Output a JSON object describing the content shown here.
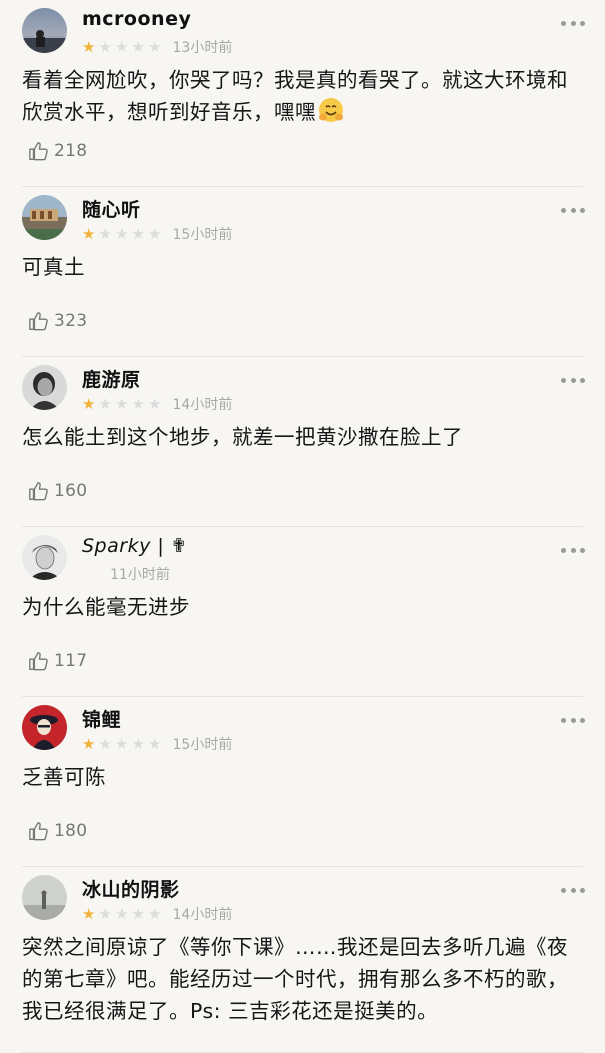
{
  "comments": [
    {
      "username": "mcrooney",
      "rating": 1,
      "max_rating": 5,
      "time": "13小时前",
      "text": "看着全网尬吹，你哭了吗？我是真的看哭了。就这大环境和欣赏水平，想听到好音乐，嘿嘿",
      "emoji": "hugging-face",
      "likes": "218",
      "avatar": "landscape-photo"
    },
    {
      "username": "随心听",
      "rating": 1,
      "max_rating": 5,
      "time": "15小时前",
      "text": "可真土",
      "likes": "323",
      "avatar": "building-photo"
    },
    {
      "username": "鹿游原",
      "rating": 1,
      "max_rating": 5,
      "time": "14小时前",
      "text": "怎么能土到这个地步，就差一把黄沙撒在脸上了",
      "likes": "160",
      "avatar": "portrait-bw"
    },
    {
      "username": "Sparky | ✟",
      "rating": null,
      "time": "11小时前",
      "text": "为什么能毫无进步",
      "likes": "117",
      "avatar": "portrait-sketch"
    },
    {
      "username": "锦鲤",
      "rating": 1,
      "max_rating": 5,
      "time": "15小时前",
      "text": "乏善可陈",
      "likes": "180",
      "avatar": "red-illustration"
    },
    {
      "username": "冰山的阴影",
      "rating": 1,
      "max_rating": 5,
      "time": "14小时前",
      "text": "突然之间原谅了《等你下课》……我还是回去多听几遍《夜的第七章》吧。能经历过一个时代，拥有那么多不朽的歌，我已经很满足了。Ps: 三吉彩花还是挺美的。",
      "likes": "",
      "avatar": "foggy-photo"
    }
  ],
  "colors": {
    "star_filled": "#f1b33b",
    "star_empty": "#dcdcdc",
    "meta_text": "#a8a8a8",
    "background": "#f7f6f3"
  },
  "icons": {
    "like": "thumbs-up-icon",
    "more": "more-dots-icon"
  }
}
